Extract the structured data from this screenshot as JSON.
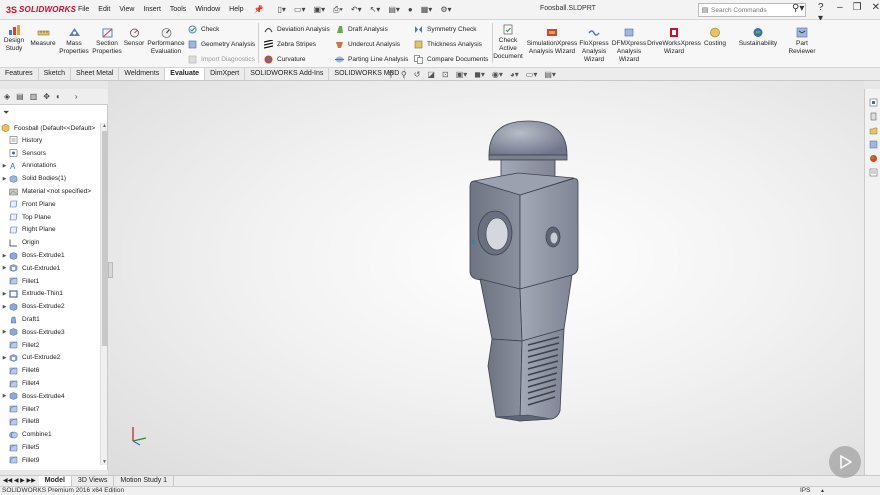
{
  "app": {
    "brand_prefix": "3S",
    "brand_name": "SOLIDWORKS",
    "document_title": "Foosball.SLDPRT",
    "menu": [
      "File",
      "Edit",
      "View",
      "Insert",
      "Tools",
      "Window",
      "Help"
    ],
    "search_placeholder": "Search Commands"
  },
  "ribbon": {
    "large_buttons": [
      {
        "label": "Design Study",
        "icon": "design-study-icon"
      },
      {
        "label": "Measure",
        "icon": "measure-icon"
      },
      {
        "label": "Mass Properties",
        "icon": "mass-properties-icon"
      },
      {
        "label": "Section Properties",
        "icon": "section-properties-icon"
      },
      {
        "label": "Sensor",
        "icon": "sensor-icon"
      },
      {
        "label": "Performance Evaluation",
        "icon": "performance-evaluation-icon"
      }
    ],
    "small_col1": [
      {
        "label": "Check",
        "icon": "check-icon",
        "disabled": false
      },
      {
        "label": "Geometry Analysis",
        "icon": "geometry-analysis-icon",
        "disabled": false
      },
      {
        "label": "Import Diagnostics",
        "icon": "import-diagnostics-icon",
        "disabled": true
      }
    ],
    "small_col2": [
      {
        "label": "Deviation Analysis",
        "icon": "deviation-analysis-icon"
      },
      {
        "label": "Zebra Stripes",
        "icon": "zebra-stripes-icon"
      },
      {
        "label": "Curvature",
        "icon": "curvature-icon"
      }
    ],
    "small_col3": [
      {
        "label": "Draft Analysis",
        "icon": "draft-analysis-icon"
      },
      {
        "label": "Undercut Analysis",
        "icon": "undercut-analysis-icon"
      },
      {
        "label": "Parting Line Analysis",
        "icon": "parting-line-analysis-icon"
      }
    ],
    "small_col4": [
      {
        "label": "Symmetry Check",
        "icon": "symmetry-check-icon"
      },
      {
        "label": "Thickness Analysis",
        "icon": "thickness-analysis-icon"
      },
      {
        "label": "Compare Documents",
        "icon": "compare-documents-icon"
      }
    ],
    "right_buttons": [
      {
        "label": "Check Active Document",
        "icon": "check-active-document-icon"
      },
      {
        "label": "SimulationXpress Analysis Wizard",
        "icon": "simulationxpress-icon"
      },
      {
        "label": "FloXpress Analysis Wizard",
        "icon": "floxpress-icon"
      },
      {
        "label": "DFMXpress Analysis Wizard",
        "icon": "dfmxpress-icon"
      },
      {
        "label": "DriveWorksXpress Wizard",
        "icon": "driveworksxpress-icon"
      },
      {
        "label": "Costing",
        "icon": "costing-icon"
      },
      {
        "label": "Sustainability",
        "icon": "sustainability-icon"
      },
      {
        "label": "Part Reviewer",
        "icon": "part-reviewer-icon"
      }
    ]
  },
  "tabs": [
    {
      "label": "Features",
      "active": false
    },
    {
      "label": "Sketch",
      "active": false
    },
    {
      "label": "Sheet Metal",
      "active": false
    },
    {
      "label": "Weldments",
      "active": false
    },
    {
      "label": "Evaluate",
      "active": true
    },
    {
      "label": "DimXpert",
      "active": false
    },
    {
      "label": "SOLIDWORKS Add-Ins",
      "active": false
    },
    {
      "label": "SOLIDWORKS MBD",
      "active": false
    }
  ],
  "feature_tree": {
    "root": "Foosball  (Default<<Default>",
    "items": [
      {
        "label": "History",
        "icon": "history-icon",
        "expandable": false
      },
      {
        "label": "Sensors",
        "icon": "sensors-icon",
        "expandable": false
      },
      {
        "label": "Annotations",
        "icon": "annotations-icon",
        "expandable": true
      },
      {
        "label": "Solid Bodies(1)",
        "icon": "solid-bodies-icon",
        "expandable": true
      },
      {
        "label": "Material <not specified>",
        "icon": "material-icon",
        "expandable": false
      },
      {
        "label": "Front Plane",
        "icon": "plane-icon",
        "expandable": false
      },
      {
        "label": "Top Plane",
        "icon": "plane-icon",
        "expandable": false
      },
      {
        "label": "Right Plane",
        "icon": "plane-icon",
        "expandable": false
      },
      {
        "label": "Origin",
        "icon": "origin-icon",
        "expandable": false
      },
      {
        "label": "Boss-Extrude1",
        "icon": "boss-extrude-icon",
        "expandable": true
      },
      {
        "label": "Cut-Extrude1",
        "icon": "cut-extrude-icon",
        "expandable": true
      },
      {
        "label": "Fillet1",
        "icon": "fillet-icon",
        "expandable": false
      },
      {
        "label": "Extrude-Thin1",
        "icon": "extrude-thin-icon",
        "expandable": true
      },
      {
        "label": "Boss-Extrude2",
        "icon": "boss-extrude-icon",
        "expandable": true
      },
      {
        "label": "Draft1",
        "icon": "draft-icon",
        "expandable": false
      },
      {
        "label": "Boss-Extrude3",
        "icon": "boss-extrude-icon",
        "expandable": true
      },
      {
        "label": "Fillet2",
        "icon": "fillet-icon",
        "expandable": false
      },
      {
        "label": "Cut-Extrude2",
        "icon": "cut-extrude-icon",
        "expandable": true
      },
      {
        "label": "Fillet6",
        "icon": "fillet-icon",
        "expandable": false
      },
      {
        "label": "Fillet4",
        "icon": "fillet-icon",
        "expandable": false
      },
      {
        "label": "Boss-Extrude4",
        "icon": "boss-extrude-icon",
        "expandable": true
      },
      {
        "label": "Fillet7",
        "icon": "fillet-icon",
        "expandable": false
      },
      {
        "label": "Fillet8",
        "icon": "fillet-icon",
        "expandable": false
      },
      {
        "label": "Combine1",
        "icon": "combine-icon",
        "expandable": false
      },
      {
        "label": "Fillet5",
        "icon": "fillet-icon",
        "expandable": false
      },
      {
        "label": "Fillet9",
        "icon": "fillet-icon",
        "expandable": false
      }
    ]
  },
  "bottom_tabs": [
    {
      "label": "Model",
      "active": true
    },
    {
      "label": "3D Views",
      "active": false
    },
    {
      "label": "Motion Study 1",
      "active": false
    }
  ],
  "status": {
    "edition": "SOLIDWORKS Premium 2016 x64 Edition",
    "units": "IPS"
  },
  "colors": {
    "brand": "#c8102e",
    "model_body": "#8f95a3",
    "accent": "#3a6fb5"
  }
}
